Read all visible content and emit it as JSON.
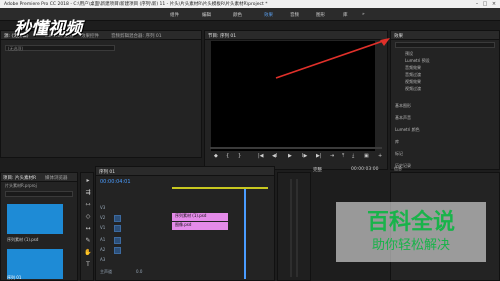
{
  "window": {
    "title": "Adobe Premiere Pro CC 2018 - C:\\用户\\桌面\\新建项目\\新建项目 (序列\\新) 11 - 片头\\片头素材R\\片头模板R\\片头素材R\\project *",
    "minimize": "–",
    "maximize": "□",
    "close": "×"
  },
  "menubar": {
    "items": [
      "组件",
      "编辑",
      "颜色",
      "效果",
      "音频",
      "图形",
      "库",
      "»"
    ],
    "active_index": 3
  },
  "source_panel": {
    "tabs": [
      "源: (无剪辑)",
      "Lumetri 范围",
      "效果控件",
      "音频剪辑混合器: 序列 01"
    ],
    "search_placeholder": "(无选项)"
  },
  "program_monitor": {
    "title": "节目: 序列 01",
    "timecode_left": "00:00:03:00",
    "fit": "适合",
    "quality": "完整",
    "timecode_right": "00:00:03:00",
    "buttons": [
      "◆",
      "{",
      "}",
      "|◀",
      "◀I",
      "▶",
      "I▶",
      "▶|",
      "⇥",
      "⤒",
      "⤓",
      "▣",
      "+"
    ]
  },
  "effects_panel": {
    "title": "效果",
    "search_placeholder": "",
    "tree": [
      "预设",
      "Lumetri 预设",
      "音频效果",
      "音频过渡",
      "视频效果",
      "视频过渡"
    ],
    "categories": [
      "基本图形",
      "基本声音",
      "Lumetri 颜色",
      "库",
      "标记",
      "历史记录",
      "信息"
    ]
  },
  "project_panel": {
    "tabs": [
      "项目: 片头素材R",
      "媒体浏览器"
    ],
    "path": "片头素材R.prproj",
    "search_placeholder": "",
    "items": [
      {
        "name": "序列素材 (1).psd"
      },
      {
        "name": "序列 01"
      }
    ]
  },
  "timeline": {
    "title": "序列 01",
    "timecode": "00:00:04:01",
    "video_tracks": [
      "V3",
      "V2",
      "V1"
    ],
    "audio_tracks": [
      "A1",
      "A2",
      "A3"
    ],
    "master": "主声道",
    "master_value": "0.0",
    "clips": [
      {
        "label": "序列素材 (1).psd",
        "color": "#e48be9"
      },
      {
        "label": "图像.psd",
        "color": "#e48be9"
      }
    ]
  },
  "watermark": {
    "logo": "秒懂视频",
    "brand": "百科全说",
    "tagline": "助你轻松解决"
  },
  "colors": {
    "accent": "#5aa0f0",
    "timecode": "#4a9cff",
    "clip": "#e48be9",
    "arrow": "#e0302a"
  }
}
